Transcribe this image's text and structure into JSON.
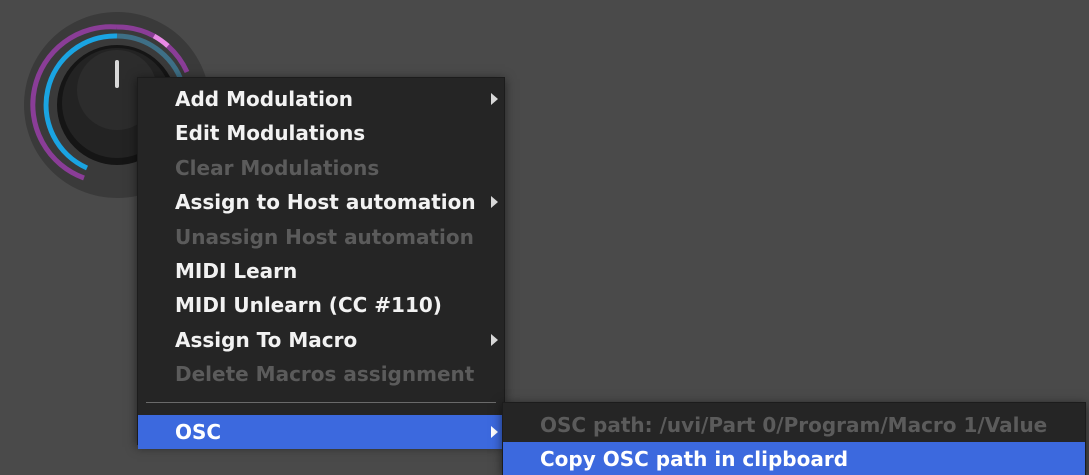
{
  "colors": {
    "background": "#4a4a4a",
    "menu_background": "#252525",
    "menu_text": "#f2f2f2",
    "menu_disabled_text": "#5b5b5b",
    "selection": "#3c69de",
    "knob_ring_purple": "#8a3d97",
    "knob_ring_cyan": "#1aa4e2",
    "knob_ring_pink": "#e98ae6",
    "knob_ring_slate": "#3e6f86"
  },
  "knob": {
    "icon": "rotary-knob",
    "value_fraction": 0.5
  },
  "context_menu": {
    "items": [
      {
        "label": "Add Modulation",
        "enabled": true,
        "has_submenu": true
      },
      {
        "label": "Edit Modulations",
        "enabled": true,
        "has_submenu": false
      },
      {
        "label": "Clear Modulations",
        "enabled": false,
        "has_submenu": false
      },
      {
        "label": "Assign to Host automation",
        "enabled": true,
        "has_submenu": true
      },
      {
        "label": "Unassign Host automation",
        "enabled": false,
        "has_submenu": false
      },
      {
        "label": "MIDI Learn",
        "enabled": true,
        "has_submenu": false
      },
      {
        "label": "MIDI Unlearn (CC #110)",
        "enabled": true,
        "has_submenu": false
      },
      {
        "label": "Assign To Macro",
        "enabled": true,
        "has_submenu": true
      },
      {
        "label": "Delete Macros assignment",
        "enabled": false,
        "has_submenu": false
      }
    ],
    "osc_item": {
      "label": "OSC",
      "selected": true,
      "has_submenu": true
    }
  },
  "osc_submenu": {
    "items": [
      {
        "label": "OSC path: /uvi/Part 0/Program/Macro 1/Value",
        "enabled": false
      },
      {
        "label": "Copy OSC path in clipboard",
        "enabled": true,
        "selected": true
      }
    ]
  }
}
